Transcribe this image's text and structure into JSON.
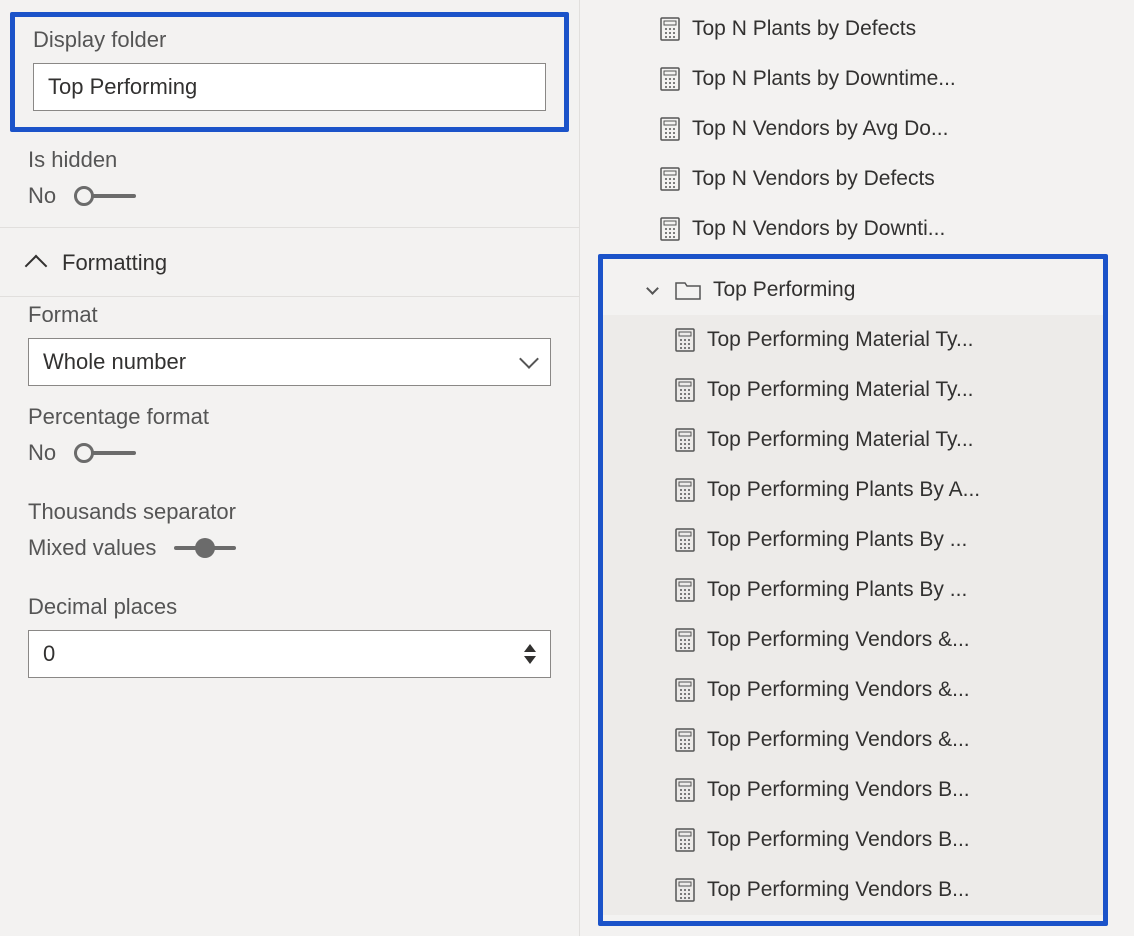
{
  "properties": {
    "display_folder": {
      "label": "Display folder",
      "value": "Top Performing"
    },
    "is_hidden": {
      "label": "Is hidden",
      "value_text": "No"
    }
  },
  "formatting": {
    "title": "Formatting",
    "format": {
      "label": "Format",
      "value": "Whole number"
    },
    "percentage_format": {
      "label": "Percentage format",
      "value_text": "No"
    },
    "thousands_separator": {
      "label": "Thousands separator",
      "value_text": "Mixed values"
    },
    "decimal_places": {
      "label": "Decimal places",
      "value": "0"
    }
  },
  "tree": {
    "top_items": [
      {
        "label": "Top N Plants by Defects"
      },
      {
        "label": "Top N Plants by Downtime..."
      },
      {
        "label": "Top N Vendors by Avg Do..."
      },
      {
        "label": "Top N Vendors by Defects"
      },
      {
        "label": "Top N Vendors by Downti..."
      }
    ],
    "folder": {
      "label": "Top Performing",
      "items": [
        {
          "label": "Top Performing Material Ty..."
        },
        {
          "label": "Top Performing Material Ty..."
        },
        {
          "label": "Top Performing Material Ty..."
        },
        {
          "label": "Top Performing Plants By A..."
        },
        {
          "label": "Top Performing Plants By ..."
        },
        {
          "label": "Top Performing Plants By ..."
        },
        {
          "label": "Top Performing Vendors &..."
        },
        {
          "label": "Top Performing Vendors &..."
        },
        {
          "label": "Top Performing Vendors &..."
        },
        {
          "label": "Top Performing Vendors B..."
        },
        {
          "label": "Top Performing Vendors B..."
        },
        {
          "label": "Top Performing Vendors B..."
        }
      ]
    }
  }
}
